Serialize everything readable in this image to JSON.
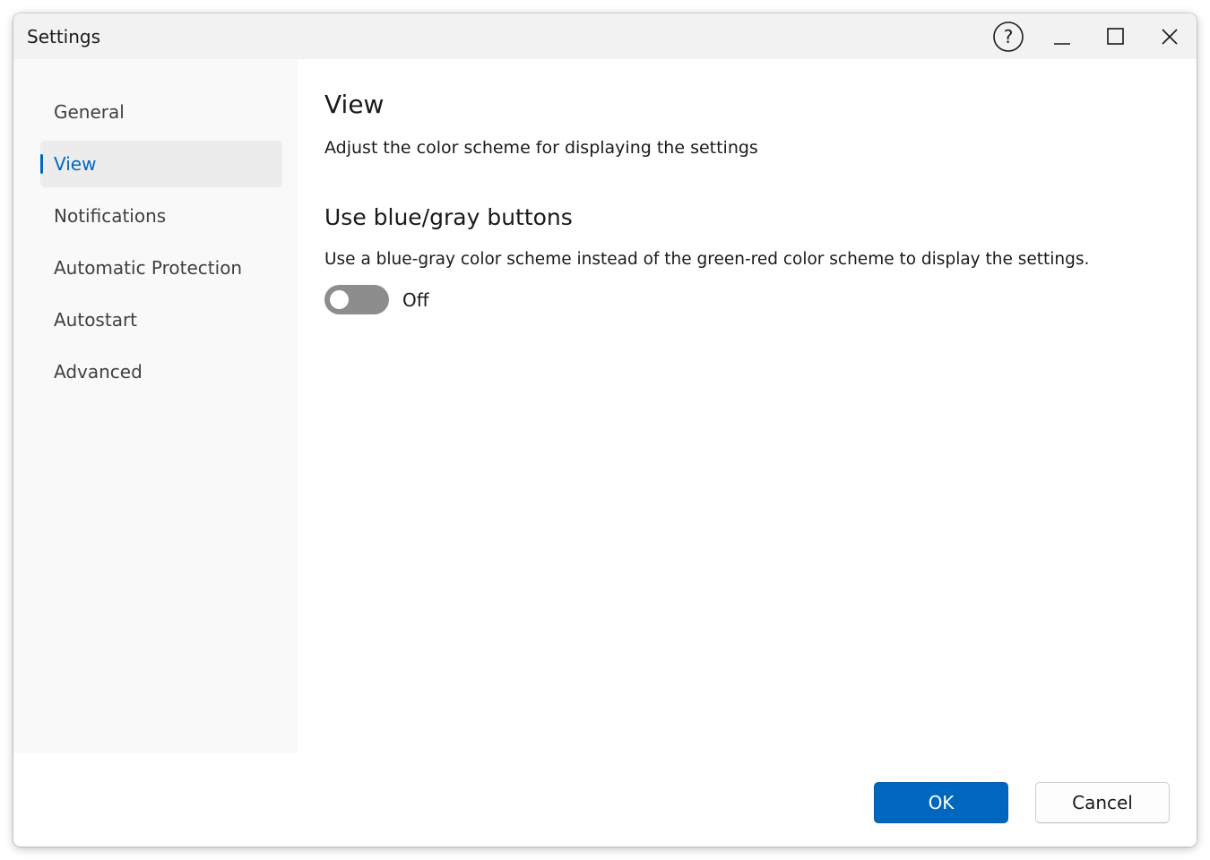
{
  "window": {
    "title": "Settings"
  },
  "titlebar_buttons": {
    "help_icon": "help-circle-icon",
    "minimize_icon": "minimize-icon",
    "maximize_icon": "maximize-icon",
    "close_icon": "close-icon"
  },
  "sidebar": {
    "selected": "View",
    "items": [
      {
        "label": "General"
      },
      {
        "label": "View"
      },
      {
        "label": "Notifications"
      },
      {
        "label": "Automatic Protection"
      },
      {
        "label": "Autostart"
      },
      {
        "label": "Advanced"
      }
    ]
  },
  "main": {
    "title": "View",
    "description": "Adjust the color scheme for displaying the settings",
    "section": {
      "title": "Use blue/gray buttons",
      "description": "Use a blue-gray color scheme instead of the green-red color scheme to display the settings.",
      "toggle_state": false,
      "toggle_label": "Off"
    }
  },
  "footer": {
    "ok_label": "OK",
    "cancel_label": "Cancel"
  },
  "colors": {
    "accent": "#0067c0",
    "sidebar_bg": "#f9f9f9",
    "titlebar_bg": "#f2f2f2",
    "toggle_off": "#8d8d8d"
  }
}
